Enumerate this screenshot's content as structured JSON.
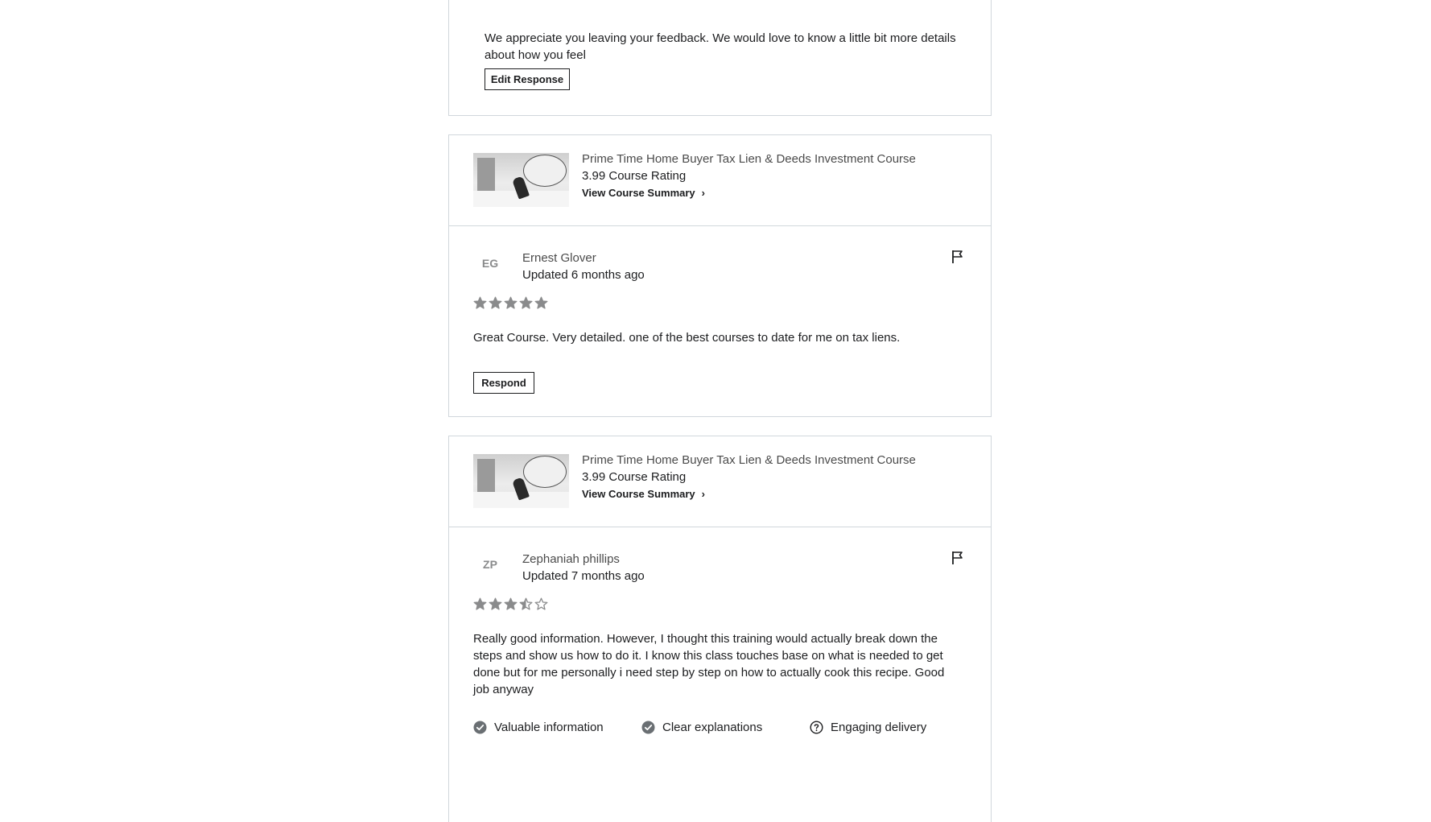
{
  "first_card": {
    "feedback_text": "We appreciate you leaving your feedback. We would love to know a little bit more details about how you feel",
    "edit_button": "Edit Response"
  },
  "reviews": [
    {
      "course_title": "Prime Time Home Buyer Tax Lien & Deeds Investment Course",
      "course_rating": "3.99 Course Rating",
      "course_link": "View Course Summary",
      "avatar_initials": "EG",
      "reviewer_name": "Ernest Glover",
      "updated": "Updated 6 months ago",
      "rating": 5,
      "text": "Great Course. Very detailed. one of the best courses to date for me on tax liens.",
      "respond_button": "Respond"
    },
    {
      "course_title": "Prime Time Home Buyer Tax Lien & Deeds Investment Course",
      "course_rating": "3.99 Course Rating",
      "course_link": "View Course Summary",
      "avatar_initials": "ZP",
      "reviewer_name": "Zephaniah phillips",
      "updated": "Updated 7 months ago",
      "rating": 3.5,
      "text": "Really good information. However, I thought this training would actually break down the steps and show us how to do it. I know this class touches base on what is needed to get done but for me personally i need step by step on how to actually cook this recipe. Good job anyway",
      "tags": [
        {
          "label": "Valuable information",
          "icon": "check-circle-icon"
        },
        {
          "label": "Clear explanations",
          "icon": "check-circle-icon"
        },
        {
          "label": "Engaging delivery",
          "icon": "question-circle-icon"
        }
      ]
    }
  ],
  "colors": {
    "border": "#d1d7dc",
    "text": "#1c1d1f",
    "muted": "#4b4b4b",
    "star": "#8a8b8c"
  }
}
